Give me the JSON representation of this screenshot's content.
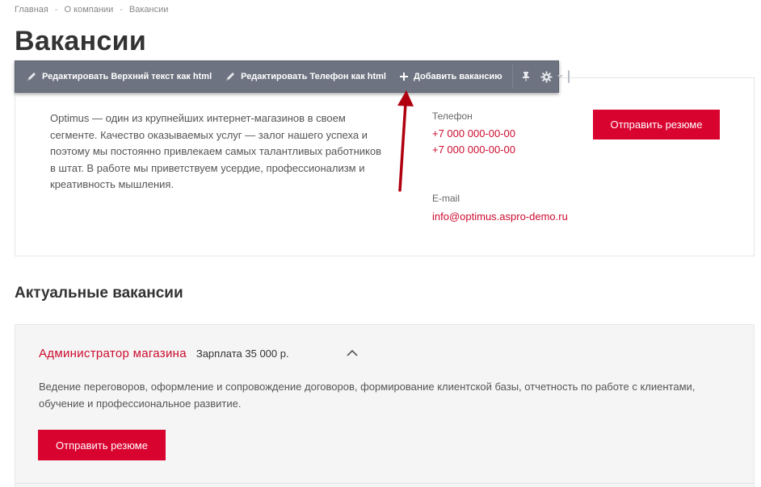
{
  "breadcrumbs": {
    "items": [
      "Главная",
      "О компании",
      "Вакансии"
    ],
    "separator": "-"
  },
  "page_title": "Вакансии",
  "admin_toolbar": {
    "edit_top_text": "Редактировать Верхний текст как html",
    "edit_phone": "Редактировать Телефон как html",
    "add_vacancy": "Добавить вакансию",
    "icons": [
      "pencil-icon",
      "plus-icon",
      "pin-icon",
      "gear-icon",
      "dropdown-caret-icon"
    ]
  },
  "info": {
    "text": "Optimus — один из крупнейших интернет-магазинов в своем сегменте. Качество оказываемых услуг — залог нашего успеха и поэтому мы постоянно привлекаем самых талантливых работников в штат. В работе мы приветствуем усердие, профессионализм и креативность мышления.",
    "phone_label": "Телефон",
    "phones": [
      "+7 000 000-00-00",
      "+7 000 000-00-00"
    ],
    "email_label": "E-mail",
    "email": "info@optimus.aspro-demo.ru",
    "resume_button": "Отправить резюме"
  },
  "vacancies_section": {
    "title": "Актуальные вакансии",
    "items": [
      {
        "title": "Администратор магазина",
        "salary": "Зарплата 35 000 р.",
        "description": "Ведение переговоров, оформление и сопровождение договоров, формирование клиентской базы, отчетность по работе с клиентами, обучение и профессиональное развитие.",
        "button": "Отправить резюме"
      }
    ]
  },
  "colors": {
    "accent": "#d9032f",
    "link": "#cc0c2f",
    "toolbar": "#6d7380",
    "arrow": "#b00010"
  }
}
